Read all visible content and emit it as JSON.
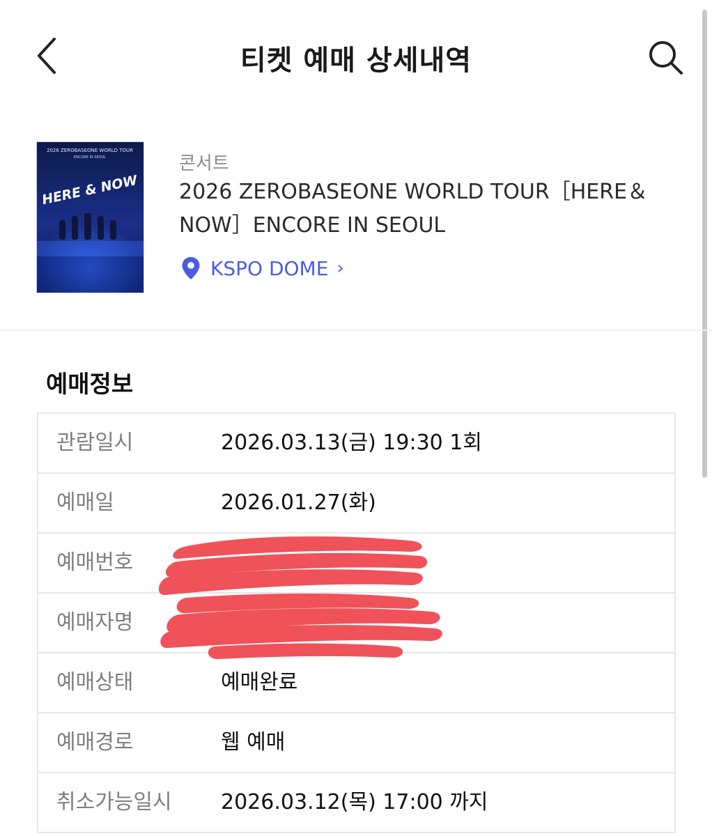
{
  "header": {
    "title": "티켓 예매 상세내역",
    "back_icon": "chevron-left-icon",
    "search_icon": "search-icon"
  },
  "event": {
    "category": "콘서트",
    "title": "2026 ZEROBASEONE WORLD TOUR［HERE＆NOW］ENCORE IN SEOUL",
    "venue": "KSPO DOME",
    "venue_chevron": "›",
    "venue_icon": "location-pin-icon",
    "accent_color": "#4a5de4",
    "poster": {
      "header_text": "2026 ZEROBASEONE WORLD TOUR",
      "subheader_text": "ENCORE IN SEOUL",
      "logo_text": "HERE & NOW"
    }
  },
  "booking": {
    "section_title": "예매정보",
    "rows": [
      {
        "label": "관람일시",
        "value": "2026.03.13(금) 19:30 1회"
      },
      {
        "label": "예매일",
        "value": "2026.01.27(화)"
      },
      {
        "label": "예매번호",
        "value": ""
      },
      {
        "label": "예매자명",
        "value": ""
      },
      {
        "label": "예매상태",
        "value": "예매완료"
      },
      {
        "label": "예매경로",
        "value": "웹 예매"
      },
      {
        "label": "취소가능일시",
        "value": "2026.03.12(목) 17:00 까지"
      }
    ],
    "redaction_color": "#f0525a"
  }
}
